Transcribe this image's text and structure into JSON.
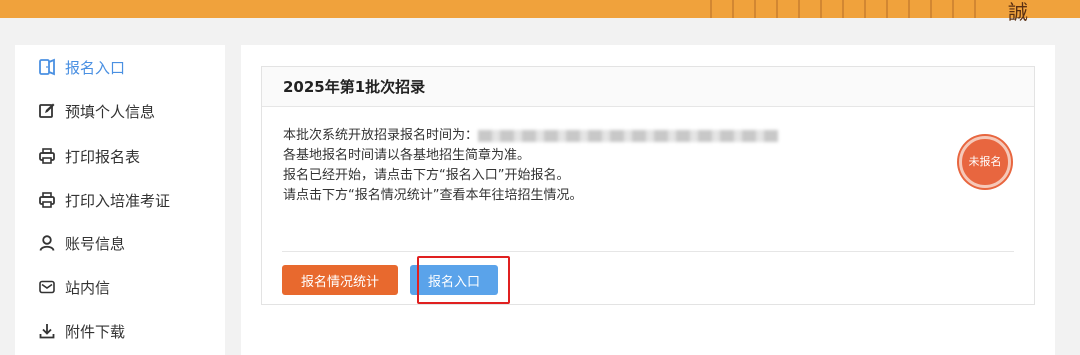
{
  "header": {
    "seal_glyph": "誠"
  },
  "sidebar": {
    "items": [
      {
        "label": "报名入口",
        "icon": "door-enter-icon",
        "active": true
      },
      {
        "label": "预填个人信息",
        "icon": "edit-icon",
        "active": false
      },
      {
        "label": "打印报名表",
        "icon": "printer-icon",
        "active": false
      },
      {
        "label": "打印入培准考证",
        "icon": "printer-icon",
        "active": false
      },
      {
        "label": "账号信息",
        "icon": "user-icon",
        "active": false
      },
      {
        "label": "站内信",
        "icon": "mail-icon",
        "active": false
      },
      {
        "label": "附件下载",
        "icon": "download-icon",
        "active": false
      }
    ]
  },
  "card": {
    "title": "2025年第1批次招录",
    "lines": {
      "time_prefix": "本批次系统开放招录报名时间为：",
      "line2": "各基地报名时间请以各基地招生简章为准。",
      "line3": "报名已经开始，请点击下方“报名入口”开始报名。",
      "line4": "请点击下方“报名情况统计”查看本年往培招生情况。"
    },
    "status_badge": "未报名",
    "buttons": {
      "stats_label": "报名情况统计",
      "enter_label": "报名入口"
    }
  },
  "colors": {
    "header_bg": "#f0a23c",
    "active_blue": "#4a90e2",
    "stats_button": "#e8692e",
    "enter_button": "#5aa3ea",
    "badge_bg": "#e8663f",
    "highlight_red": "#e02020"
  }
}
